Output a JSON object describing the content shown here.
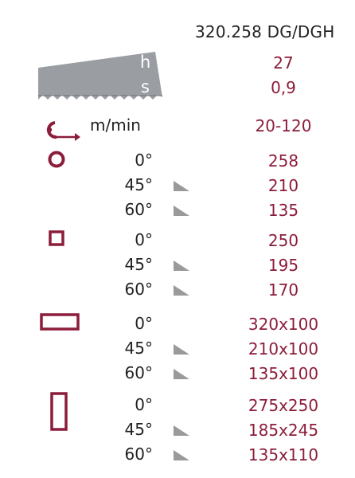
{
  "title": "320.258 DG/DGH",
  "blade": {
    "h_label": "h",
    "s_label": "s",
    "h_value": "27",
    "s_value": "0,9"
  },
  "speed": {
    "unit": "m/min",
    "value": "20-120"
  },
  "groups": [
    {
      "shape": "round-icon",
      "rows": [
        {
          "angle": "0°",
          "value": "258"
        },
        {
          "angle": "45°",
          "value": "210"
        },
        {
          "angle": "60°",
          "value": "135"
        }
      ]
    },
    {
      "shape": "square-icon",
      "rows": [
        {
          "angle": "0°",
          "value": "250"
        },
        {
          "angle": "45°",
          "value": "195"
        },
        {
          "angle": "60°",
          "value": "170"
        }
      ]
    },
    {
      "shape": "flat-rectangle-icon",
      "rows": [
        {
          "angle": "0°",
          "value": "320x100"
        },
        {
          "angle": "45°",
          "value": "210x100"
        },
        {
          "angle": "60°",
          "value": "135x100"
        }
      ]
    },
    {
      "shape": "tall-rectangle-icon",
      "rows": [
        {
          "angle": "0°",
          "value": "275x250"
        },
        {
          "angle": "45°",
          "value": "185x245"
        },
        {
          "angle": "60°",
          "value": "135x110"
        }
      ]
    }
  ],
  "colors": {
    "accent": "#8c1d3a",
    "blade": "#9a9ea2",
    "triangle": "#9a9a9a",
    "text": "#222222"
  }
}
